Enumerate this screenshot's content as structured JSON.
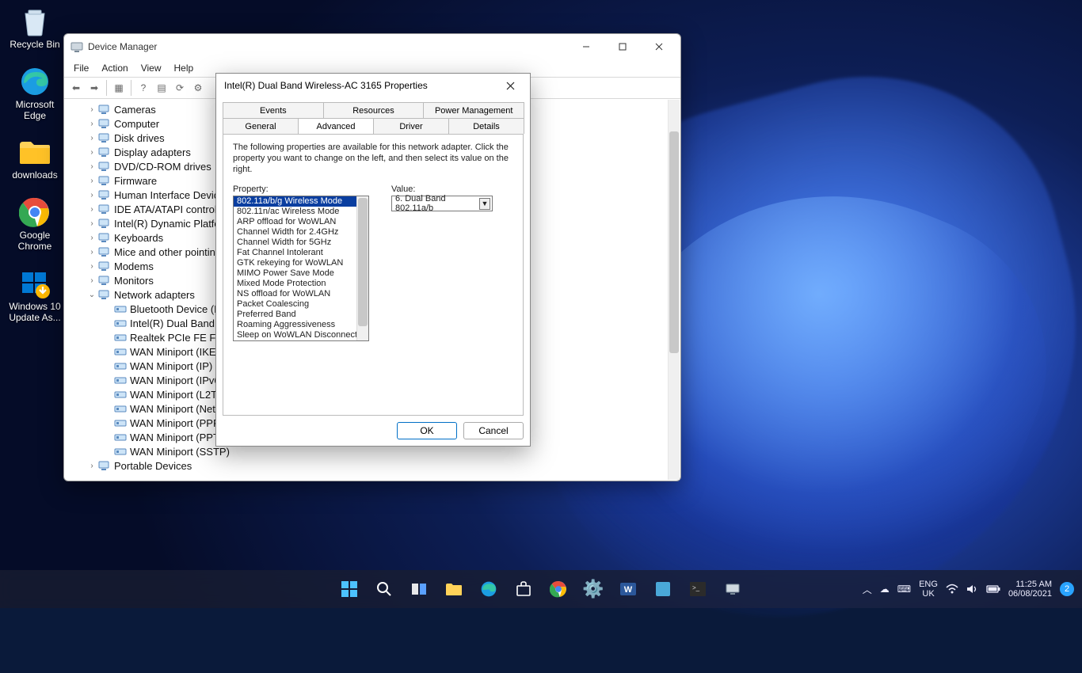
{
  "desktop": {
    "icons": [
      {
        "label": "Recycle Bin",
        "glyph": "recycle"
      },
      {
        "label": "Microsoft Edge",
        "glyph": "edge"
      },
      {
        "label": "downloads",
        "glyph": "folder"
      },
      {
        "label": "Google Chrome",
        "glyph": "chrome"
      },
      {
        "label": "Windows 10 Update As...",
        "glyph": "winupdate"
      }
    ]
  },
  "device_manager": {
    "title": "Device Manager",
    "menu": [
      "File",
      "Action",
      "View",
      "Help"
    ],
    "tree": [
      {
        "label": "Cameras",
        "expanded": false
      },
      {
        "label": "Computer",
        "expanded": false
      },
      {
        "label": "Disk drives",
        "expanded": false
      },
      {
        "label": "Display adapters",
        "expanded": false
      },
      {
        "label": "DVD/CD-ROM drives",
        "expanded": false
      },
      {
        "label": "Firmware",
        "expanded": false
      },
      {
        "label": "Human Interface Device",
        "expanded": false
      },
      {
        "label": "IDE ATA/ATAPI controlle",
        "expanded": false
      },
      {
        "label": "Intel(R) Dynamic Platfor",
        "expanded": false
      },
      {
        "label": "Keyboards",
        "expanded": false
      },
      {
        "label": "Mice and other pointing",
        "expanded": false
      },
      {
        "label": "Modems",
        "expanded": false
      },
      {
        "label": "Monitors",
        "expanded": false
      },
      {
        "label": "Network adapters",
        "expanded": true,
        "children": [
          {
            "label": "Bluetooth Device (Pe"
          },
          {
            "label": "Intel(R) Dual Band W"
          },
          {
            "label": "Realtek PCIe FE Fam"
          },
          {
            "label": "WAN Miniport (IKEv"
          },
          {
            "label": "WAN Miniport (IP)"
          },
          {
            "label": "WAN Miniport (IPv6"
          },
          {
            "label": "WAN Miniport (L2TP"
          },
          {
            "label": "WAN Miniport (Netw"
          },
          {
            "label": "WAN Miniport (PPP"
          },
          {
            "label": "WAN Miniport (PPTP"
          },
          {
            "label": "WAN Miniport (SSTP)"
          }
        ]
      },
      {
        "label": "Portable Devices",
        "expanded": false
      }
    ]
  },
  "properties": {
    "title": "Intel(R) Dual Band Wireless-AC 3165 Properties",
    "tabs_row1": [
      "Events",
      "Resources",
      "Power Management"
    ],
    "tabs_row2": [
      "General",
      "Advanced",
      "Driver",
      "Details"
    ],
    "active_tab": "Advanced",
    "intro": "The following properties are available for this network adapter. Click the property you want to change on the left, and then select its value on the right.",
    "property_label": "Property:",
    "value_label": "Value:",
    "properties_list": [
      "802.11a/b/g Wireless Mode",
      "802.11n/ac Wireless Mode",
      "ARP offload for WoWLAN",
      "Channel Width for 2.4GHz",
      "Channel Width for 5GHz",
      "Fat Channel Intolerant",
      "GTK rekeying for WoWLAN",
      "MIMO Power Save Mode",
      "Mixed Mode Protection",
      "NS offload for WoWLAN",
      "Packet Coalescing",
      "Preferred Band",
      "Roaming Aggressiveness",
      "Sleep on WoWLAN Disconnect"
    ],
    "selected_property_index": 0,
    "value_selected": "6. Dual Band 802.11a/b",
    "ok": "OK",
    "cancel": "Cancel"
  },
  "taskbar": {
    "lang1": "ENG",
    "lang2": "UK",
    "time": "11:25 AM",
    "date": "06/08/2021",
    "badge": "2"
  }
}
